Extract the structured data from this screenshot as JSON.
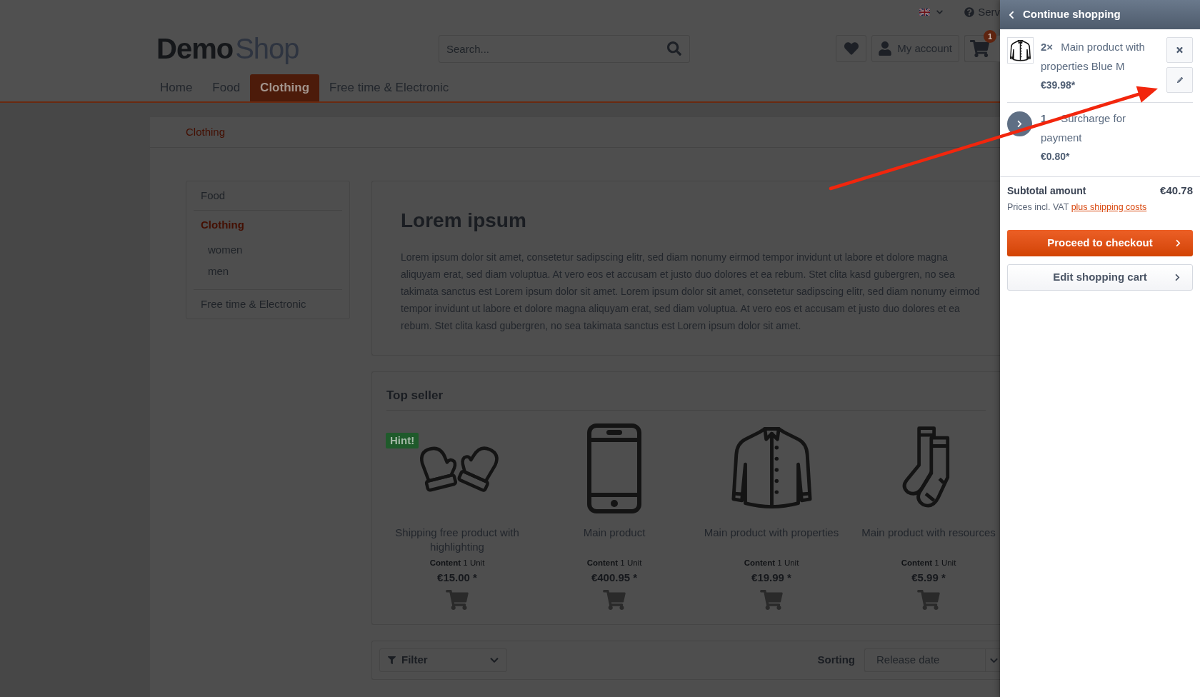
{
  "top_bar": {
    "service_link": "Serv"
  },
  "header": {
    "logo": {
      "bold_part": "Demo",
      "light_part": "Shop"
    },
    "search": {
      "placeholder": "Search..."
    },
    "account_button": "My account",
    "cart_badge": "1"
  },
  "nav": [
    {
      "label": "Home",
      "selected": false
    },
    {
      "label": "Food",
      "selected": false
    },
    {
      "label": "Clothing",
      "selected": true
    },
    {
      "label": "Free time & Electronic",
      "selected": false
    }
  ],
  "breadcrumb": [
    "Clothing"
  ],
  "sidebar": {
    "items": [
      {
        "label": "Food",
        "selected": false
      },
      {
        "label": "Clothing",
        "selected": true,
        "children": [
          {
            "label": "women",
            "selected": false
          },
          {
            "label": "men",
            "selected": false
          }
        ]
      },
      {
        "label": "Free time & Electronic",
        "selected": false
      }
    ]
  },
  "content": {
    "title": "Lorem ipsum",
    "text": "Lorem ipsum dolor sit amet, consetetur sadipscing elitr, sed diam nonumy eirmod tempor invidunt ut labore et dolore magna aliquyam erat, sed diam voluptua. At vero eos et accusam et justo duo dolores et ea rebum. Stet clita kasd gubergren, no sea takimata sanctus est Lorem ipsum dolor sit amet. Lorem ipsum dolor sit amet, consetetur sadipscing elitr, sed diam nonumy eirmod tempor invidunt ut labore et dolore magna aliquyam erat, sed diam voluptua. At vero eos et accusam et justo duo dolores et ea rebum. Stet clita kasd gubergren, no sea takimata sanctus est Lorem ipsum dolor sit amet."
  },
  "top_seller": {
    "title": "Top seller",
    "products": [
      {
        "name": "Shipping free product with highlighting",
        "badge": "Hint!",
        "content": "**Content** 1 Unit",
        "price": "€15.00 *"
      },
      {
        "name": "Main product",
        "content": "**Content** 1 Unit",
        "price": "€400.95 *"
      },
      {
        "name": "Main product with properties",
        "content": "**Content** 1 Unit",
        "price": "€19.99 *"
      },
      {
        "name": "Main product with resources",
        "content": "**Content** 1 Unit",
        "price": "€5.99 *"
      }
    ]
  },
  "listing_bar": {
    "filter_button": "Filter",
    "sorting_label": "Sorting",
    "sorting_value": "Release date"
  },
  "cart_panel": {
    "header": "Continue shopping",
    "items": [
      {
        "kind": "product",
        "text": "**2×** Main product with properties Blue M",
        "price": "€39.98*"
      },
      {
        "kind": "surcharge",
        "text": "**1** Surcharge for payment",
        "price": "€0.80*"
      }
    ],
    "subtotal_label": "Subtotal amount",
    "subtotal": "€40.78",
    "vat_note": "Prices incl. VAT",
    "shipping_link": "plus shipping costs",
    "checkout_button": "Proceed to checkout",
    "edit_cart_button": "Edit shopping cart"
  }
}
